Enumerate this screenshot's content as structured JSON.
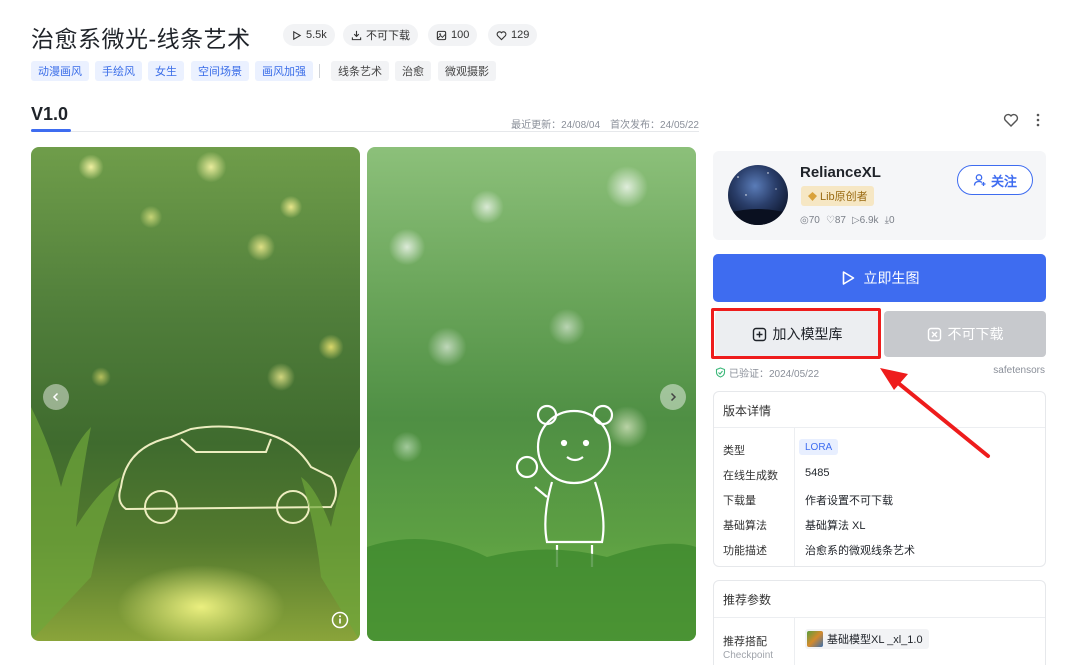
{
  "header": {
    "title": "治愈系微光-线条艺术",
    "stats": {
      "runs": "5.5k",
      "download": "不可下载",
      "images": "100",
      "likes": "129"
    },
    "tags_blue": [
      "动漫画风",
      "手绘风",
      "女生",
      "空间场景",
      "画风加强"
    ],
    "tags_gray": [
      "线条艺术",
      "治愈",
      "微观摄影"
    ]
  },
  "version": {
    "label": "V1.0",
    "updated": "最近更新：24/08/04",
    "published": "首次发布：24/05/22"
  },
  "author": {
    "name": "RelianceXL",
    "badge": "Lib原创者",
    "followers": "70",
    "likes": "87",
    "runs": "6.9k",
    "downloads": "0",
    "follow_label": "关注"
  },
  "actions": {
    "generate_label": "立即生图",
    "add_label": "加入模型库",
    "no_download_label": "不可下载"
  },
  "verification": {
    "verified": "已验证：2024/05/22",
    "format": "safetensors"
  },
  "details": {
    "title": "版本详情",
    "rows": [
      {
        "key": "类型",
        "value": "LORA"
      },
      {
        "key": "在线生成数",
        "value": "5485"
      },
      {
        "key": "下载量",
        "value": "作者设置不可下载"
      },
      {
        "key": "基础算法",
        "value": "基础算法 XL"
      },
      {
        "key": "功能描述",
        "value": "治愈系的微观线条艺术"
      }
    ]
  },
  "params": {
    "title": "推荐参数",
    "rec_label": "推荐搭配",
    "rec_sub": "Checkpoint",
    "model_name": "基础模型XL _xl_1.0"
  },
  "colors": {
    "accent": "#3e6cf0",
    "highlight": "#ee1c1c",
    "badge_bg": "#f6e7c4"
  }
}
